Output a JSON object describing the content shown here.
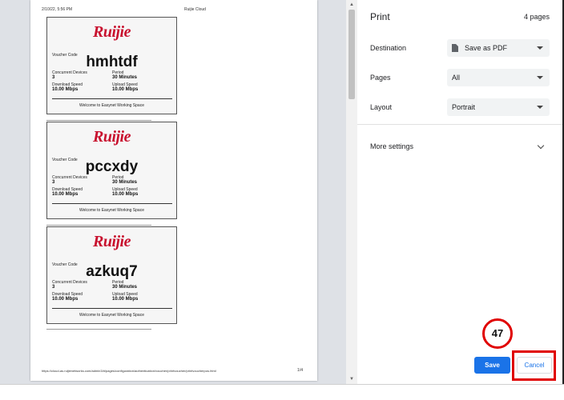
{
  "preview": {
    "header_datetime": "2/10/22, 5:56 PM",
    "header_title": "Ruijie Cloud",
    "footer_url": "https://cloud-as.ruijienetworks.com/admin3/#/pages/configuration/authentication/voucher/printvoucher/printvoucherpos.html",
    "footer_page": "1/4",
    "vouchers": [
      {
        "logo": "Ruijie",
        "code_label": "Voucher Code",
        "code": "hmhtdf",
        "devices_label": "Concurrent Devices",
        "devices": "3",
        "period_label": "Period",
        "period": "30 Minutes",
        "download_label": "Download Speed",
        "download": "10.00 Mbps",
        "upload_label": "Upload Speed",
        "upload": "10.00 Mbps",
        "welcome": "Welcome to Easynet Working Space"
      },
      {
        "logo": "Ruijie",
        "code_label": "Voucher Code",
        "code": "pccxdy",
        "devices_label": "Concurrent Devices",
        "devices": "3",
        "period_label": "Period",
        "period": "30 Minutes",
        "download_label": "Download Speed",
        "download": "10.00 Mbps",
        "upload_label": "Upload Speed",
        "upload": "10.00 Mbps",
        "welcome": "Welcome to Easynet Working Space"
      },
      {
        "logo": "Ruijie",
        "code_label": "Voucher Code",
        "code": "azkuq7",
        "devices_label": "Concurrent Devices",
        "devices": "3",
        "period_label": "Period",
        "period": "30 Minutes",
        "download_label": "Download Speed",
        "download": "10.00 Mbps",
        "upload_label": "Upload Speed",
        "upload": "10.00 Mbps",
        "welcome": "Welcome to Easynet Working Space"
      }
    ]
  },
  "panel": {
    "title": "Print",
    "page_count": "4 pages",
    "destination_label": "Destination",
    "destination_value": "Save as PDF",
    "pages_label": "Pages",
    "pages_value": "All",
    "layout_label": "Layout",
    "layout_value": "Portrait",
    "more_settings": "More settings",
    "save_label": "Save",
    "cancel_label": "Cancel"
  },
  "annotation": {
    "step_number": "47",
    "highlight_color": "#e00000"
  },
  "colors": {
    "accent": "#1a73e8",
    "brand_red": "#c8102e"
  }
}
